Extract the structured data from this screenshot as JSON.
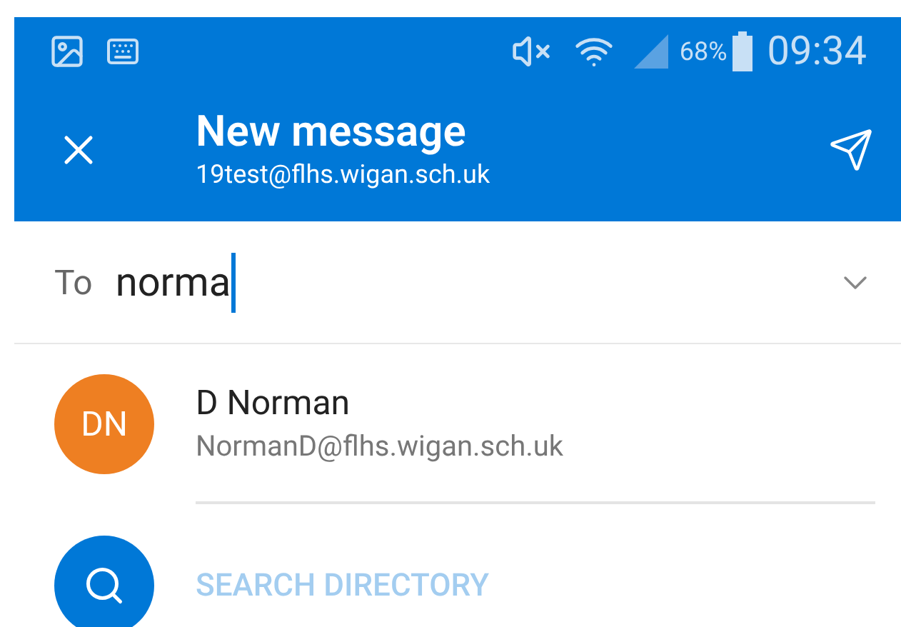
{
  "status_bar": {
    "battery": "68%",
    "time": "09:34"
  },
  "header": {
    "title": "New message",
    "account": "19test@flhs.wigan.sch.uk"
  },
  "to_field": {
    "label": "To",
    "value": "norma"
  },
  "suggestions": [
    {
      "kind": "contact",
      "initials": "DN",
      "name": "D Norman",
      "email": "NormanD@flhs.wigan.sch.uk",
      "color": "#ee7f22"
    },
    {
      "kind": "directory",
      "label": "SEARCH DIRECTORY"
    }
  ]
}
